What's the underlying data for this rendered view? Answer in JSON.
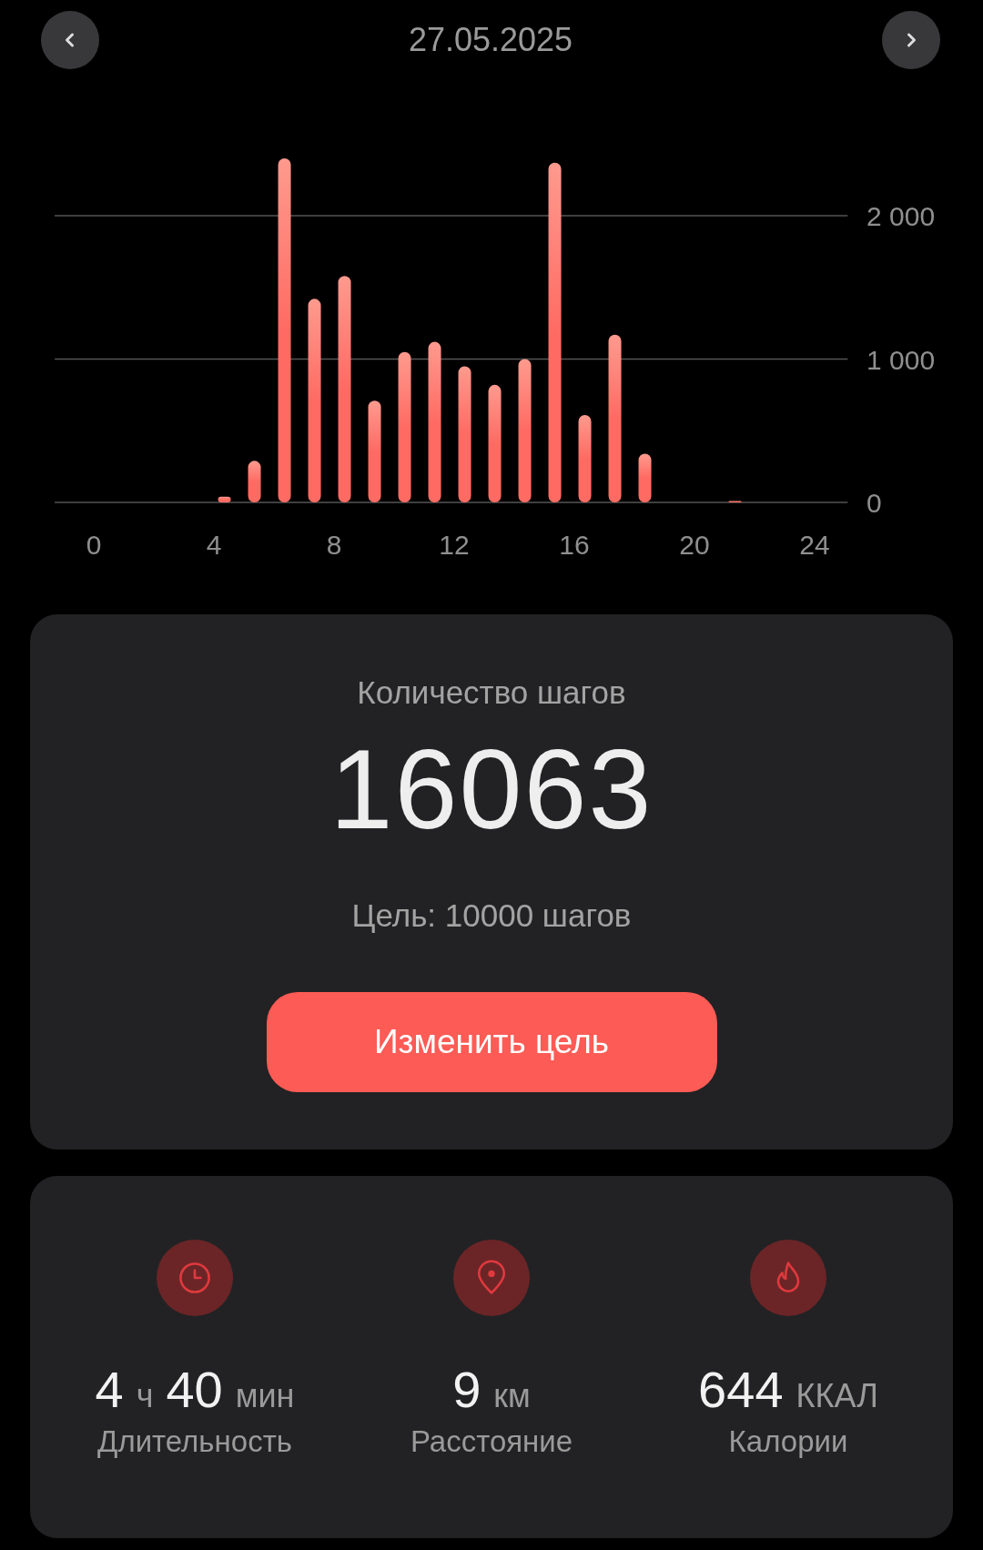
{
  "header": {
    "date": "27.05.2025"
  },
  "chart": {
    "chart_data": {
      "type": "bar",
      "x": [
        0.35,
        1.35,
        2.35,
        3.35,
        4.35,
        5.35,
        6.35,
        7.35,
        8.35,
        9.35,
        10.35,
        11.35,
        12.35,
        13.35,
        14.35,
        15.35,
        16.35,
        17.35,
        18.35,
        19.35,
        20.35,
        21.35,
        22.35,
        23.35
      ],
      "series": [
        {
          "color": "#ff6b63",
          "values": [
            0,
            0,
            0,
            0,
            40,
            290,
            2400,
            1420,
            1580,
            710,
            1050,
            1120,
            950,
            820,
            1000,
            2370,
            610,
            1170,
            340,
            0,
            0,
            10,
            0,
            0
          ]
        }
      ],
      "xlim": [
        -1.3,
        25.1
      ],
      "ylim": [
        0,
        2400
      ],
      "xticks": [
        0,
        4,
        8,
        12,
        16,
        20,
        24
      ],
      "yticks": [
        {
          "value": 0,
          "label": "0"
        },
        {
          "value": 1000,
          "label": "1 000"
        },
        {
          "value": 2000,
          "label": "2 000"
        }
      ]
    }
  },
  "steps_card": {
    "title": "Количество шагов",
    "count": "16063",
    "goal": "Цель: 10000 шагов",
    "button": "Изменить цель"
  },
  "stats": [
    {
      "parts": [
        {
          "kind": "number",
          "text": "4"
        },
        {
          "kind": "unit",
          "text": "ч"
        },
        {
          "kind": "number",
          "text": "40"
        },
        {
          "kind": "unit",
          "text": "мин"
        }
      ],
      "label": "Длительность"
    },
    {
      "parts": [
        {
          "kind": "number",
          "text": "9"
        },
        {
          "kind": "unit",
          "text": "км"
        }
      ],
      "label": "Расстояние"
    },
    {
      "parts": [
        {
          "kind": "number",
          "text": "644"
        },
        {
          "kind": "unit",
          "text": "ККАЛ"
        }
      ],
      "label": "Калории"
    }
  ]
}
